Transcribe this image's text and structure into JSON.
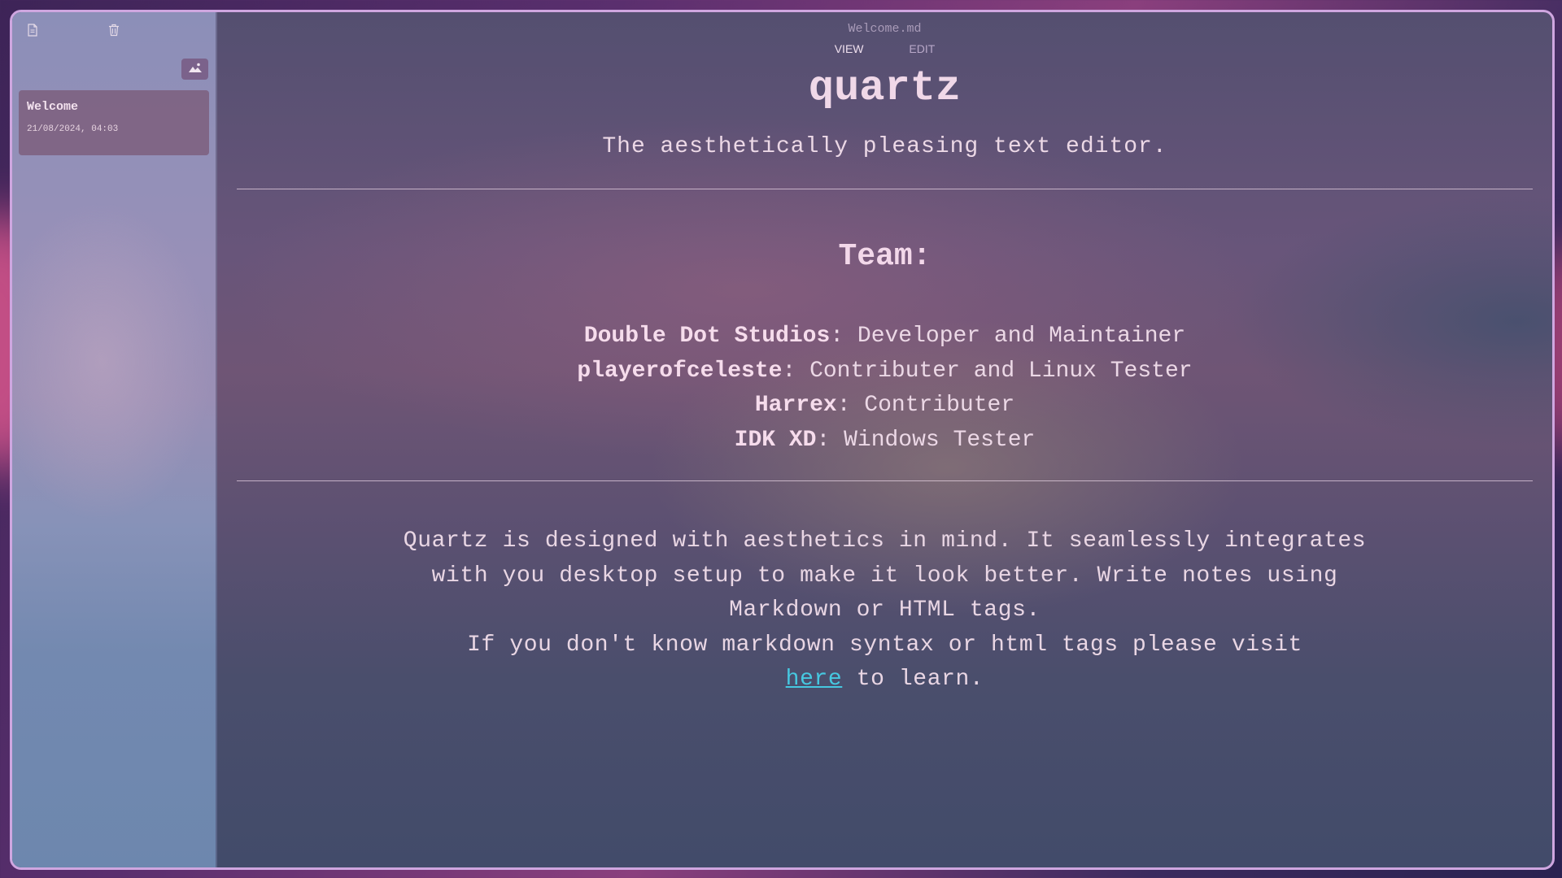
{
  "window": {
    "border_color": "#cfa6e0"
  },
  "sidebar": {
    "toolbar": {
      "new_note_icon": "new-document-icon",
      "delete_icon": "trash-icon",
      "background_icon": "image-icon"
    },
    "notes": [
      {
        "title": "Welcome",
        "date": "21/08/2024, 04:03"
      }
    ]
  },
  "editor": {
    "filename": "Welcome.md",
    "tabs": {
      "view": "VIEW",
      "edit": "EDIT"
    },
    "active_tab": "VIEW",
    "content": {
      "title": "quartz",
      "tagline": "The aesthetically pleasing text editor.",
      "team_heading": "Team:",
      "team": [
        {
          "name": "Double Dot Studios",
          "role": ": Developer and Maintainer"
        },
        {
          "name": "playerofceleste",
          "role": ": Contributer and Linux Tester"
        },
        {
          "name": "Harrex",
          "role": ": Contributer"
        },
        {
          "name": "IDK XD",
          "role": ": Windows Tester"
        }
      ],
      "paragraph_lines": [
        "Quartz is designed with aesthetics in mind. It seamlessly integrates",
        "with you desktop setup to make it look better. Write notes using",
        "Markdown or HTML tags.",
        "If you don't know markdown syntax or html tags please visit"
      ],
      "link_text": "here",
      "link_suffix": " to learn."
    }
  },
  "colors": {
    "link": "#46c8e0",
    "text": "#eedae8",
    "note_card": "#7d5f7d"
  }
}
